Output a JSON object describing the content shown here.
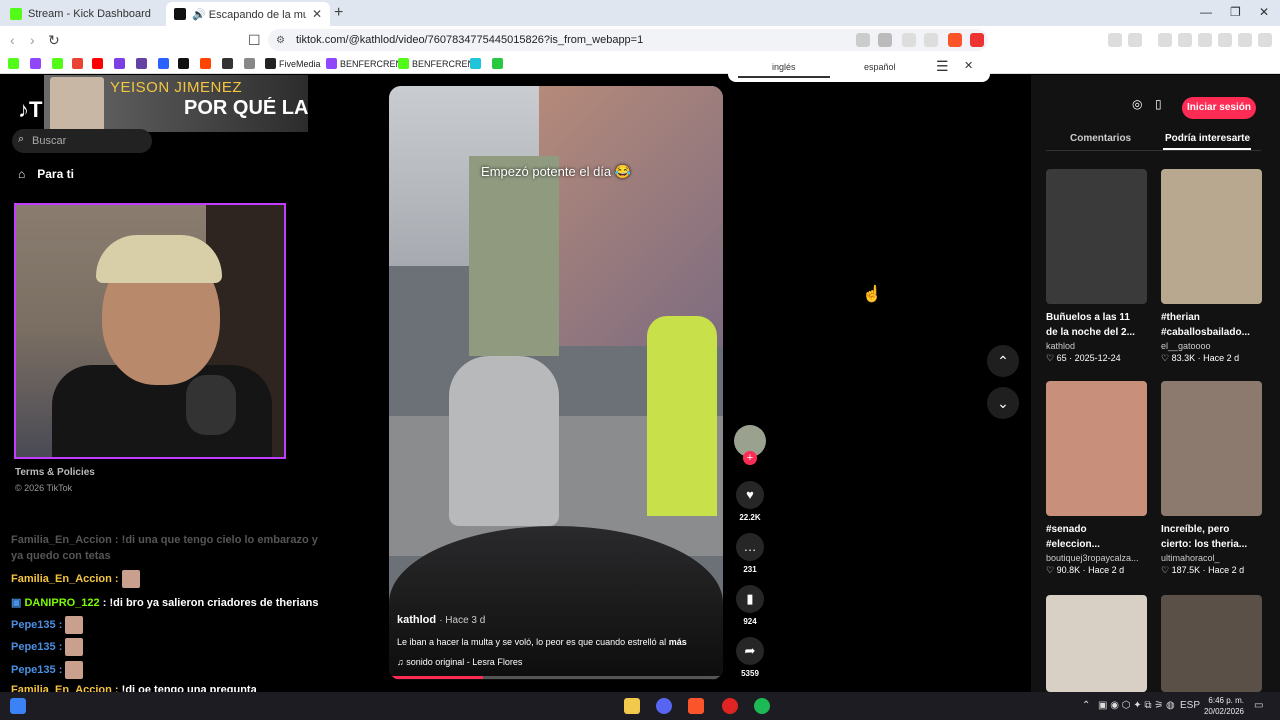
{
  "browser": {
    "tabs": [
      {
        "title": "Stream - Kick Dashboard"
      },
      {
        "title": "🔊 Escapando de la multa en Col"
      }
    ],
    "url": "tiktok.com/@kathlod/video/7607834775445015826?is_from_webapp=1",
    "bookmarks": [
      "FiveMedia",
      "BENFERCREN",
      "BENFERCREN"
    ]
  },
  "translate_bar": {
    "source": "inglés",
    "target": "español"
  },
  "overlay": {
    "name": "YEISON JIMENEZ",
    "title": "POR QUÉ LA I"
  },
  "tiktok": {
    "search_placeholder": "Buscar",
    "nav_for_you": "Para ti",
    "terms": "Terms & Policies",
    "copyright": "© 2026 TikTok",
    "signin": "Iniciar sesión",
    "tabs": {
      "comments": "Comentarios",
      "suggested": "Podría interesarte"
    }
  },
  "video": {
    "caption_overlay": "Empezó potente el día 😂",
    "author": "kathlod",
    "ago": "· Hace 3 d",
    "description": "Le iban a hacer la multa y se voló, lo peor es que cuando estrelló al",
    "more": "más",
    "sound": "sonido original - Lesra Flores",
    "progress": 0.28,
    "likes": "22.2K",
    "comments": "231",
    "saves": "924",
    "shares": "5359"
  },
  "chat": [
    {
      "user": "Familia_En_Accion",
      "text": "!di una que tengo cielo lo embarazo y ya quedo con tetas",
      "faded": true,
      "color": "#555555"
    },
    {
      "user": "Familia_En_Accion",
      "text": "",
      "emote": true,
      "color": "#f5c542"
    },
    {
      "user": "DANIPRO_122",
      "text": "!di bro ya salieron criadores de therians",
      "color": "#7cfc00"
    },
    {
      "user": "Pepe135",
      "text": "",
      "emote": true,
      "color": "#4a90e2"
    },
    {
      "user": "Pepe135",
      "text": "",
      "emote": true,
      "color": "#4a90e2"
    },
    {
      "user": "Pepe135",
      "text": "",
      "emote": true,
      "color": "#4a90e2"
    },
    {
      "user": "Familia_En_Accion",
      "text": "!di oe tengo una pregunta",
      "color": "#f5c542"
    }
  ],
  "suggested": [
    {
      "title1": "Buñuelos a las 11",
      "title2": "de la noche del 2...",
      "user": "kathlod",
      "likes": "65",
      "date": "2025-12-24",
      "thumb": "#3a3a3a"
    },
    {
      "title1": "#therian",
      "title2": "#caballosbailado...",
      "user": "el__gatoooo",
      "likes": "83.3K",
      "date": "Hace 2 d",
      "thumb": "#b8a890"
    },
    {
      "title1": "#senado",
      "title2": "#eleccion...",
      "user": "boutiquej3ropaycalza...",
      "likes": "90.8K",
      "date": "Hace 2 d",
      "thumb": "#c8907a"
    },
    {
      "title1": "Increíble, pero",
      "title2": "cierto: los theria...",
      "user": "ultimahoracol_",
      "likes": "187.5K",
      "date": "Hace 2 d",
      "thumb": "#8c7a6e"
    },
    {
      "title1": "",
      "title2": "",
      "user": "",
      "likes": "",
      "date": "",
      "thumb": "#d8d0c4"
    },
    {
      "title1": "",
      "title2": "",
      "user": "",
      "likes": "",
      "date": "",
      "thumb": "#5a5048"
    }
  ],
  "taskbar": {
    "lang": "ESP",
    "time": "6:46 p. m.",
    "date": "20/02/2026"
  },
  "colors": {
    "accent": "#fe2c55",
    "webcam_border": "#c23dff"
  }
}
